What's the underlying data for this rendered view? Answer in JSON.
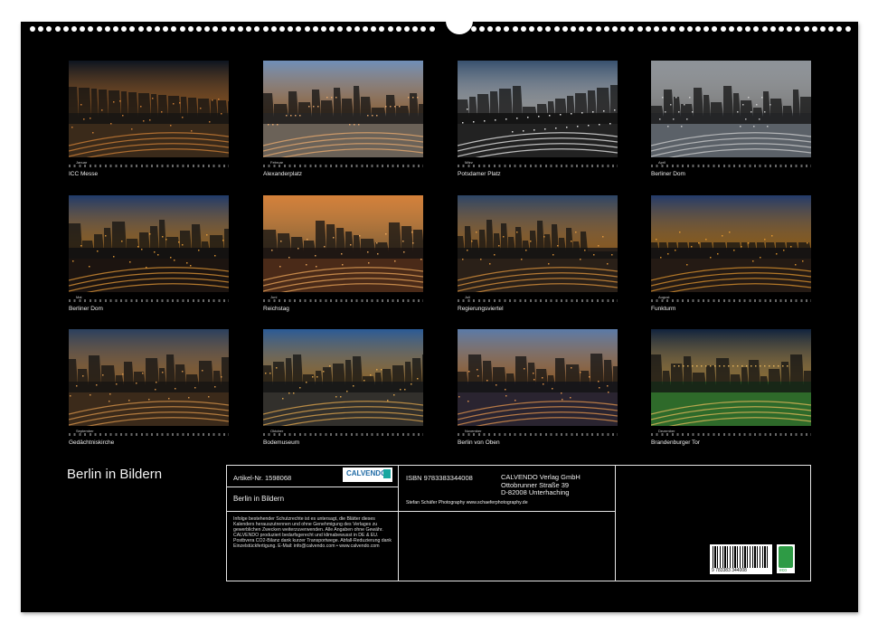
{
  "calendar": {
    "title": "Berlin in Bildern",
    "months": [
      {
        "month": "Januar",
        "caption": "ICC Messe",
        "scene": "night-city",
        "sky": "#0c1420",
        "ground": "#3a2a1a",
        "light": "#e08a3a"
      },
      {
        "month": "Februar",
        "caption": "Alexanderplatz",
        "scene": "tower-dusk",
        "sky": "#6f8fb8",
        "ground": "#6b6258",
        "light": "#f4b070"
      },
      {
        "month": "März",
        "caption": "Potsdamer Platz",
        "scene": "skyscrapers",
        "sky": "#37506e",
        "ground": "#222",
        "light": "#ffffff"
      },
      {
        "month": "April",
        "caption": "Berliner Dom",
        "scene": "cathedral-day",
        "sky": "#8d9399",
        "ground": "#5b6168",
        "light": "#d7d7d7"
      },
      {
        "month": "Mai",
        "caption": "Berliner Dom",
        "scene": "cathedral-night",
        "sky": "#1f3a6a",
        "ground": "#1c1410",
        "light": "#f2a33a"
      },
      {
        "month": "Juni",
        "caption": "Reichstag",
        "scene": "sunset",
        "sky": "#d4803a",
        "ground": "#4a2a18",
        "light": "#f8b060"
      },
      {
        "month": "Juli",
        "caption": "Regierungsviertel",
        "scene": "river-dusk",
        "sky": "#2c4466",
        "ground": "#2a2018",
        "light": "#f0a040"
      },
      {
        "month": "August",
        "caption": "Funkturm",
        "scene": "radio-tower",
        "sky": "#223a6a",
        "ground": "#241a14",
        "light": "#f0a030"
      },
      {
        "month": "September",
        "caption": "Gedächtniskirche",
        "scene": "church-blue",
        "sky": "#2a3f5e",
        "ground": "#3b2a1a",
        "light": "#e8a050"
      },
      {
        "month": "Oktober",
        "caption": "Bodemuseum",
        "scene": "museum",
        "sky": "#2a5a96",
        "ground": "#32302c",
        "light": "#f0b050"
      },
      {
        "month": "November",
        "caption": "Berlin von Oben",
        "scene": "aerial-dusk",
        "sky": "#5a7aa8",
        "ground": "#2a2430",
        "light": "#f4a050"
      },
      {
        "month": "Dezember",
        "caption": "Brandenburger Tor",
        "scene": "gate-christmas",
        "sky": "#10233e",
        "ground": "#2e6a2a",
        "light": "#f4c060"
      }
    ]
  },
  "info": {
    "article": "Artikel-Nr. 1598068",
    "logo": "CALVENDO",
    "book_title": "Berlin in Bildern",
    "legal": "Infolge bestehender Schutzrechte ist es untersagt, die Blätter dieses Kalenders herauszutrennen und ohne Genehmigung des Verlages zu gewerblichen Zwecken weiterzuverwenden. Alle Angaben ohne Gewähr. CALVENDO produziert bedarfsgerecht und klimabewusst in DE & EU. Postbvera CO2-Bilanz dank kurzer Transportwege. Abfall-Reduzierung dank Einzelstückfertigung. E-Mail: info@calvendo.com • www.calvendo.com",
    "isbn": "ISBN 9783383344008",
    "publisher": [
      "CALVENDO Verlag GmbH",
      "Ottobrunner Straße 39",
      "D-82008 Unterhaching"
    ],
    "photographer": "Stefan Schäfer Photography www.schaeferphotography.de",
    "barcode_number": "9 783383 344008",
    "eco_label": "eco"
  }
}
